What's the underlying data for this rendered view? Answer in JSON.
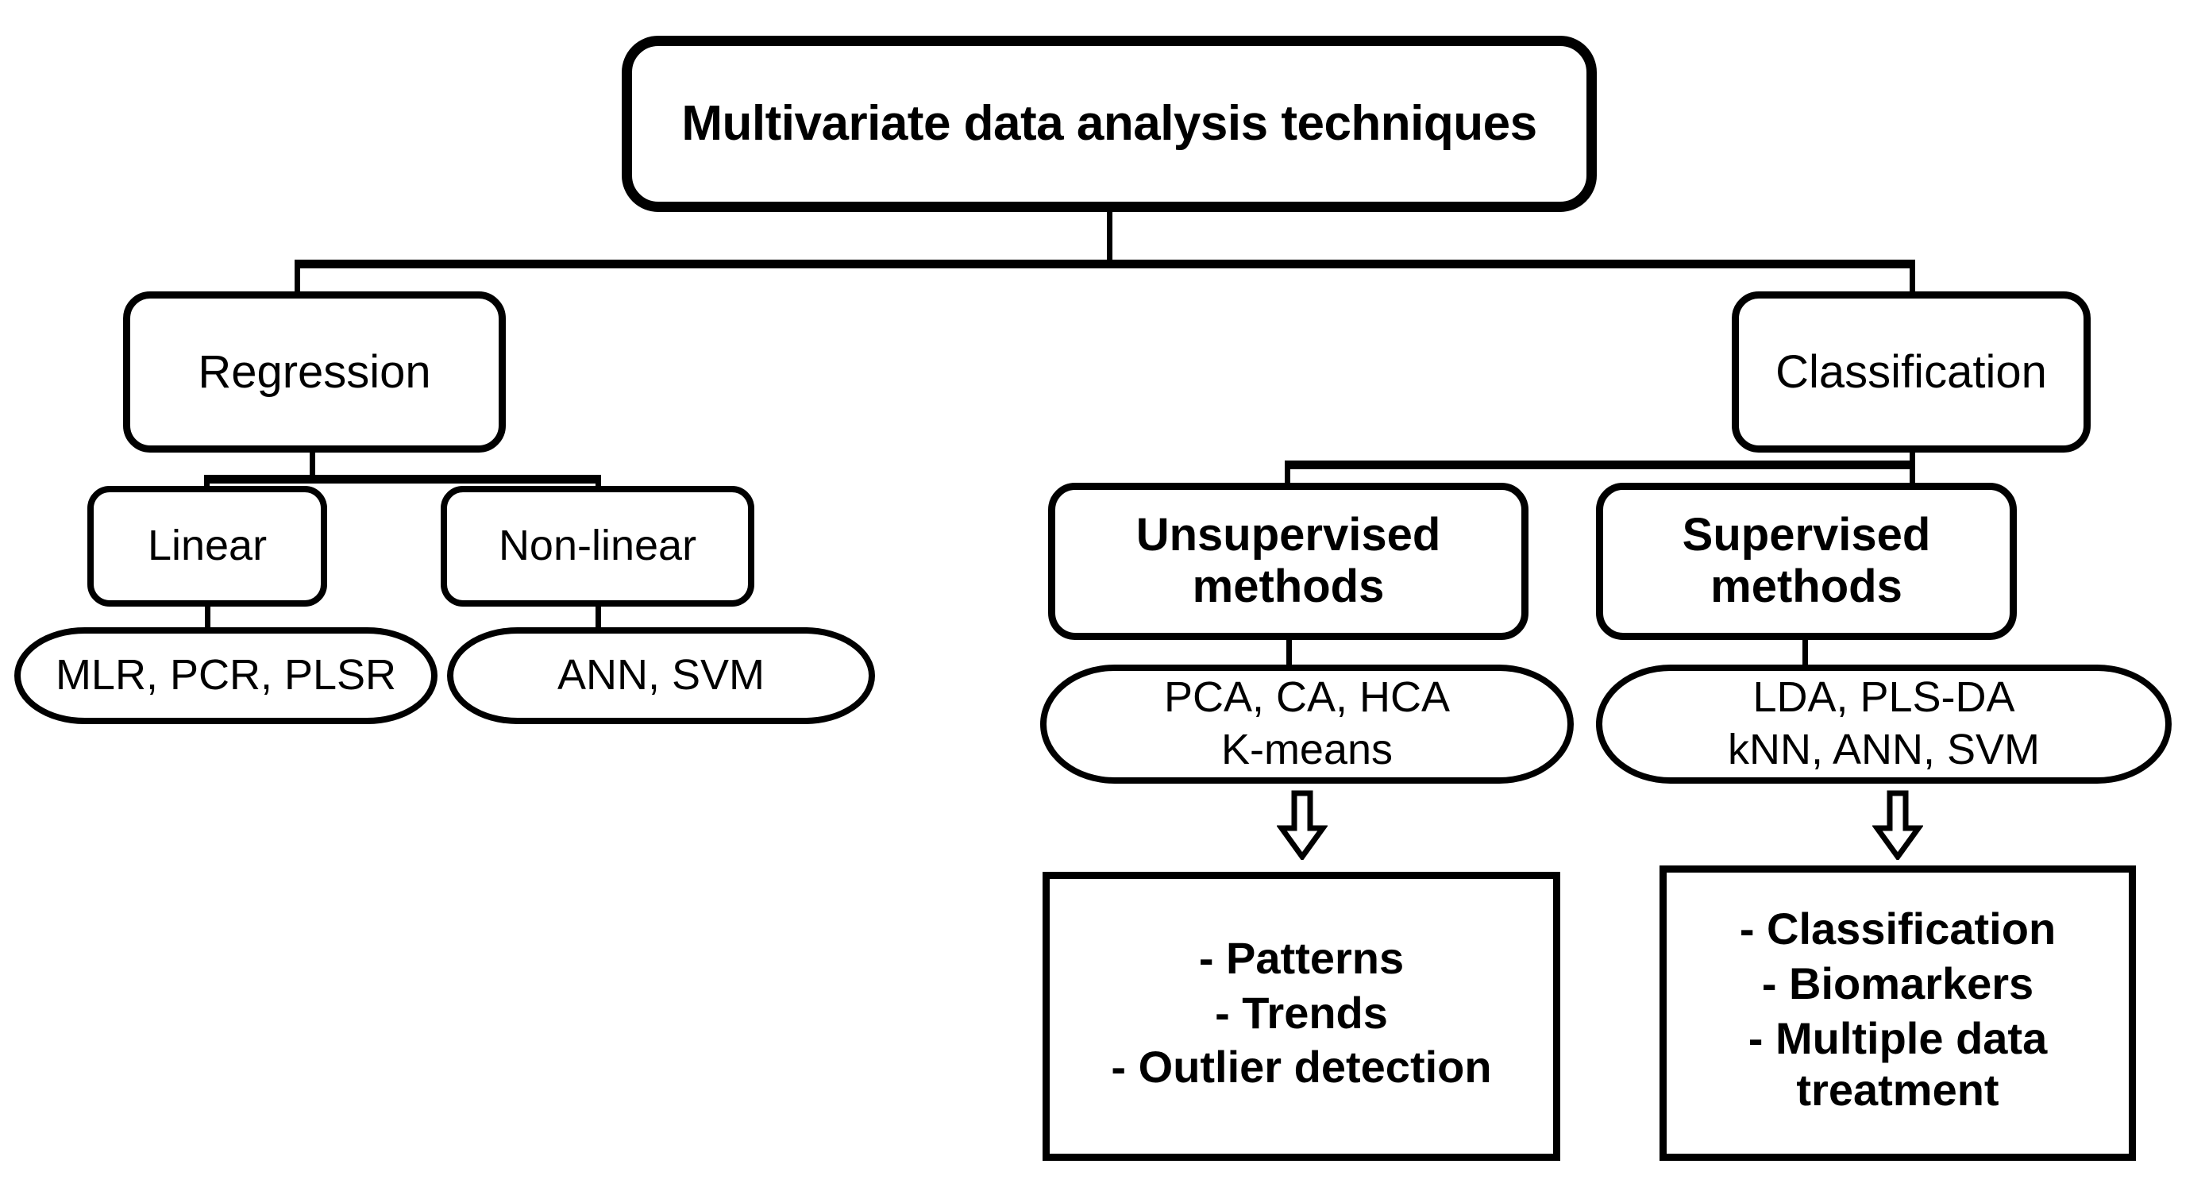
{
  "diagram": {
    "title": "Multivariate data analysis techniques",
    "root": {
      "label": "Multivariate data analysis techniques"
    },
    "branches": {
      "regression": {
        "label": "Regression"
      },
      "classification": {
        "label": "Classification"
      }
    },
    "regression_children": {
      "linear": {
        "label": "Linear"
      },
      "nonlinear": {
        "label": "Non-linear"
      }
    },
    "regression_methods": {
      "linear_methods": {
        "label": "MLR, PCR, PLSR"
      },
      "nonlinear_methods": {
        "label": "ANN, SVM"
      }
    },
    "classification_children": {
      "unsupervised": {
        "line1": "Unsupervised",
        "line2": "methods"
      },
      "supervised": {
        "line1": "Supervised",
        "line2": "methods"
      }
    },
    "classification_methods": {
      "unsupervised_methods": {
        "line1": "PCA, CA, HCA",
        "line2": "K-means"
      },
      "supervised_methods": {
        "line1": "LDA, PLS-DA",
        "line2": "kNN, ANN, SVM"
      }
    },
    "outcomes": {
      "unsupervised": {
        "items": [
          "- Patterns",
          "- Trends",
          "- Outlier detection"
        ]
      },
      "supervised": {
        "items": [
          "- Classification",
          "- Biomarkers",
          "- Multiple data treatment"
        ]
      }
    },
    "icons": {
      "down_arrow": "hollow-down-arrow"
    },
    "colors": {
      "stroke": "#000000",
      "background": "#ffffff",
      "text": "#000000"
    }
  }
}
